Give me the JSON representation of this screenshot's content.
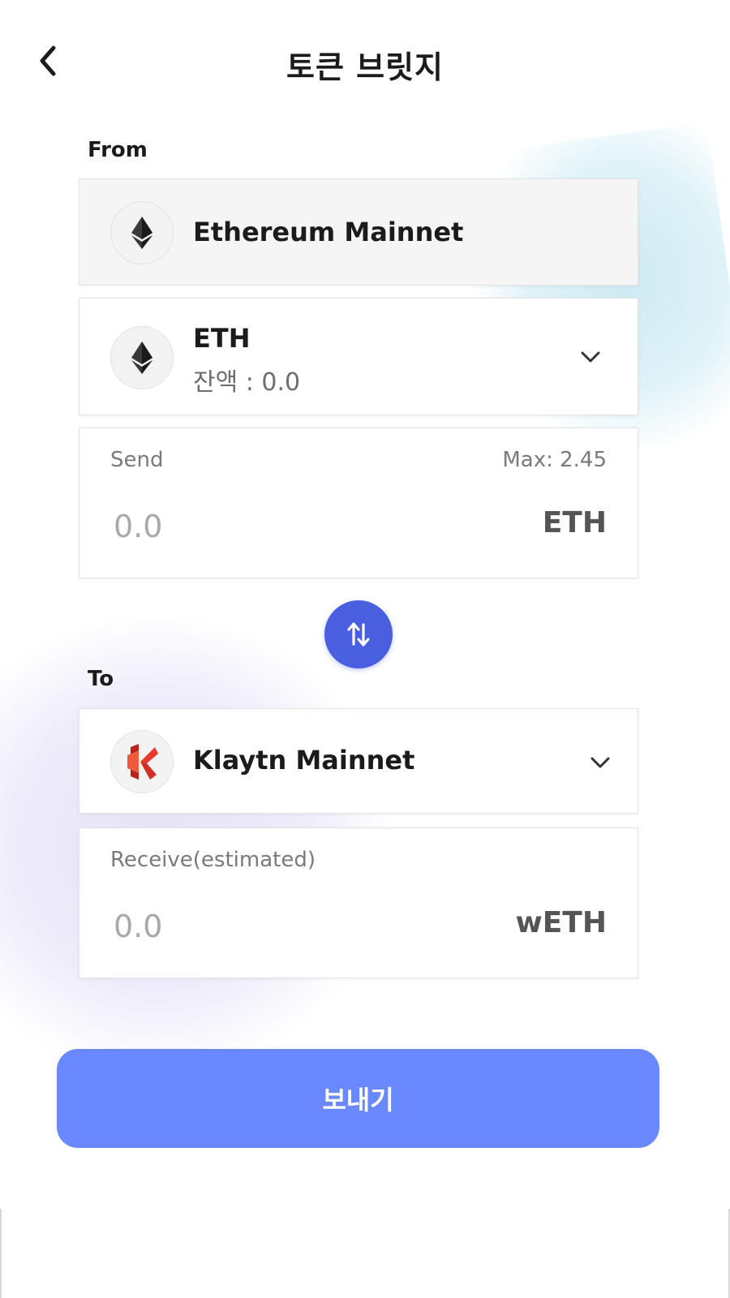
{
  "header": {
    "title": "토큰 브릿지"
  },
  "from": {
    "label": "From",
    "network": {
      "name": "Ethereum Mainnet",
      "icon": "ethereum-icon"
    },
    "token": {
      "symbol": "ETH",
      "balance": "잔액 : 0.0",
      "icon": "ethereum-icon"
    },
    "send": {
      "label": "Send",
      "max": "Max: 2.45",
      "placeholder": "0.0",
      "unit": "ETH"
    }
  },
  "swap": {
    "icon": "swap-arrows-icon"
  },
  "to": {
    "label": "To",
    "network": {
      "name": "Klaytn Mainnet",
      "icon": "klaytn-icon"
    },
    "receive": {
      "label": "Receive(estimated)",
      "placeholder": "0.0",
      "unit": "wETH"
    }
  },
  "actions": {
    "send_label": "보내기"
  },
  "colors": {
    "accent": "#4a5fe0",
    "primary_button": "#6a88ff",
    "klaytn_red": "#e8392e"
  }
}
